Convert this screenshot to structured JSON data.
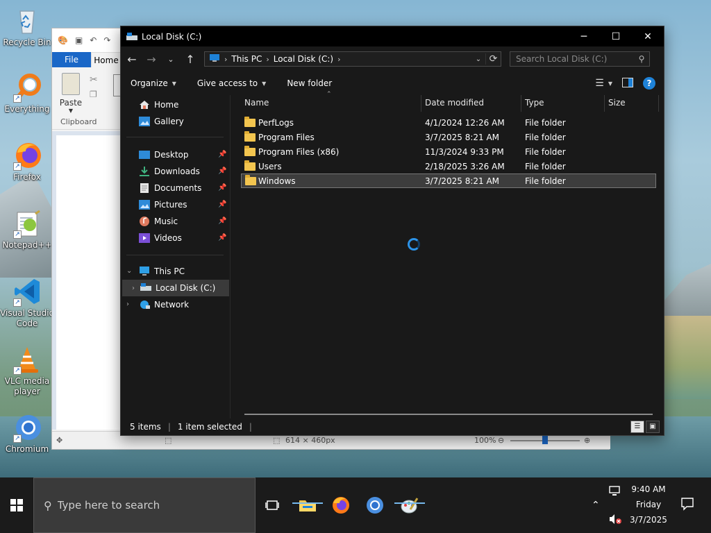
{
  "desktop": {
    "icons": [
      {
        "label": "Recycle Bin",
        "icon": "recycle-bin-icon"
      },
      {
        "label": "Everything",
        "icon": "search-magnifier-icon"
      },
      {
        "label": "Firefox",
        "icon": "firefox-icon"
      },
      {
        "label": "Notepad++",
        "icon": "notepad-plus-plus-icon"
      },
      {
        "label": "Visual Studio Code",
        "icon": "vscode-icon"
      },
      {
        "label": "VLC media player",
        "icon": "vlc-cone-icon"
      },
      {
        "label": "Chromium",
        "icon": "chromium-icon"
      }
    ]
  },
  "paint": {
    "tab_file": "File",
    "tab_home": "Home",
    "paste_label": "Paste",
    "group_clipboard": "Clipboard",
    "status_size": "614 × 460px",
    "status_zoom": "100%"
  },
  "explorer": {
    "title": "Local Disk (C:)",
    "breadcrumb": [
      "This PC",
      "Local Disk (C:)"
    ],
    "search_placeholder": "Search Local Disk (C:)",
    "commands": {
      "organize": "Organize",
      "give_access": "Give access to",
      "new_folder": "New folder"
    },
    "nav": {
      "home": "Home",
      "gallery": "Gallery",
      "desktop": "Desktop",
      "downloads": "Downloads",
      "documents": "Documents",
      "pictures": "Pictures",
      "music": "Music",
      "videos": "Videos",
      "this_pc": "This PC",
      "local_disk": "Local Disk (C:)",
      "network": "Network"
    },
    "columns": {
      "name": "Name",
      "date": "Date modified",
      "type": "Type",
      "size": "Size"
    },
    "rows": [
      {
        "name": "PerfLogs",
        "date": "4/1/2024 12:26 AM",
        "type": "File folder"
      },
      {
        "name": "Program Files",
        "date": "3/7/2025 8:21 AM",
        "type": "File folder"
      },
      {
        "name": "Program Files (x86)",
        "date": "11/3/2024 9:33 PM",
        "type": "File folder"
      },
      {
        "name": "Users",
        "date": "2/18/2025 3:26 AM",
        "type": "File folder"
      },
      {
        "name": "Windows",
        "date": "3/7/2025 8:21 AM",
        "type": "File folder"
      }
    ],
    "status": {
      "items": "5 items",
      "selected": "1 item selected"
    }
  },
  "taskbar": {
    "search_placeholder": "Type here to search",
    "time": "9:40 AM",
    "day": "Friday",
    "date": "3/7/2025"
  },
  "colors": {
    "accent": "#1e82d8",
    "explorer_bg": "#191919",
    "taskbar_bg": "#1b1b1b",
    "folder": "#f3c54f"
  }
}
